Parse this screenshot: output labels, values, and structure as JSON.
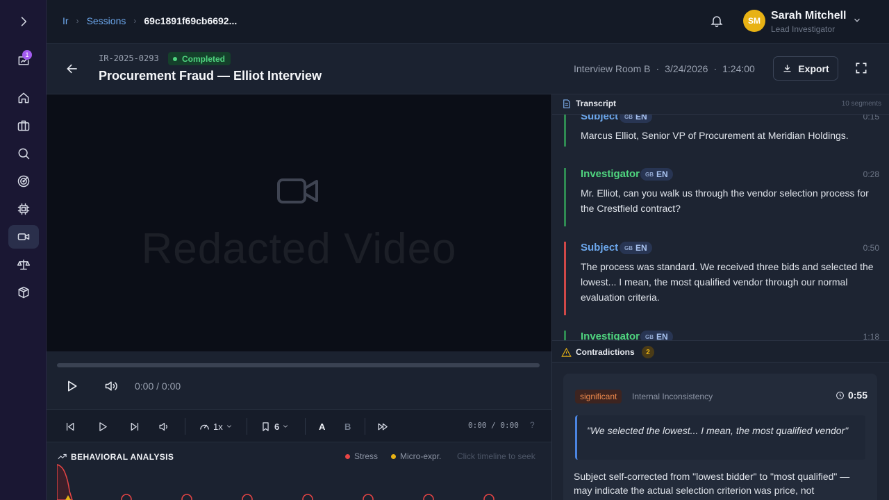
{
  "nav": {
    "unread_count": "1"
  },
  "breadcrumb": {
    "root": "Ir",
    "section": "Sessions",
    "current": "69c1891f69cb6692..."
  },
  "user": {
    "initials": "SM",
    "name": "Sarah Mitchell",
    "role": "Lead Investigator"
  },
  "session": {
    "case_id": "IR-2025-0293",
    "status": "Completed",
    "title": "Procurement Fraud — Elliot Interview",
    "room": "Interview Room B",
    "date": "3/24/2026",
    "duration": "1:24:00",
    "export_label": "Export"
  },
  "video": {
    "placeholder_text": "Redacted Video",
    "time": "0:00 / 0:00"
  },
  "toolbar": {
    "speed": "1x",
    "bookmarks": "6",
    "track_a": "A",
    "track_b": "B",
    "time": "0:00 / 0:00",
    "help": "?"
  },
  "behavior": {
    "title": "BEHAVIORAL ANALYSIS",
    "legend_stress": "Stress",
    "legend_micro": "Micro-expr.",
    "hint": "Click timeline to seek"
  },
  "transcript": {
    "title": "Transcript",
    "count": "10 segments",
    "segments": [
      {
        "speaker": "Subject",
        "lang_flag": "GB",
        "lang": "EN",
        "time": "0:15",
        "text": "Marcus Elliot, Senior VP of Procurement at Meridian Holdings."
      },
      {
        "speaker": "Investigator",
        "lang_flag": "GB",
        "lang": "EN",
        "time": "0:28",
        "text": "Mr. Elliot, can you walk us through the vendor selection process for the Crestfield contract?"
      },
      {
        "speaker": "Subject",
        "lang_flag": "GB",
        "lang": "EN",
        "time": "0:50",
        "text": "The process was standard. We received three bids and selected the lowest... I mean, the most qualified vendor through our normal evaluation criteria."
      },
      {
        "speaker": "Investigator",
        "lang_flag": "GB",
        "lang": "EN",
        "time": "1:18",
        "text": ""
      }
    ]
  },
  "contradictions": {
    "title": "Contradictions",
    "count": "2",
    "items": [
      {
        "severity": "significant",
        "type": "Internal Inconsistency",
        "time": "0:55",
        "quote": "\"We selected the lowest... I mean, the most qualified vendor\"",
        "description": "Subject self-corrected from \"lowest bidder\" to \"most qualified\" — may indicate the actual selection criterion was price, not"
      }
    ]
  },
  "colors": {
    "accent": "#6ca7ec",
    "subject": "#6ca7ec",
    "investigator": "#4fd47f",
    "stress": "#e84545",
    "micro": "#e8b214",
    "completed": "#4fd47f"
  }
}
